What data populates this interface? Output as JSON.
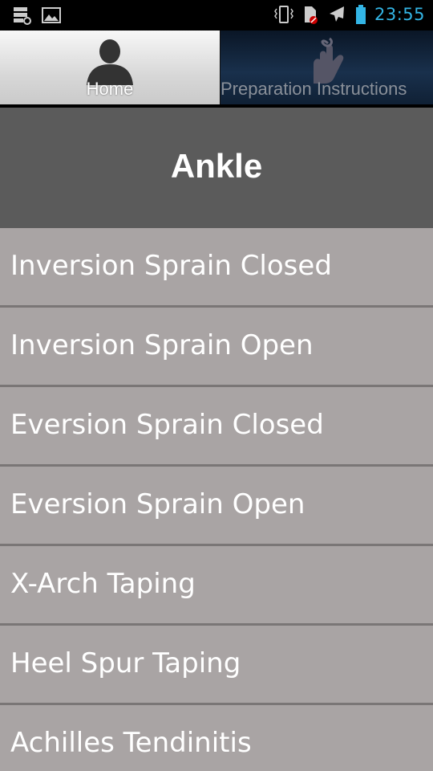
{
  "status_bar": {
    "time": "23:55",
    "left_icons": [
      "storage-icon",
      "image-icon"
    ],
    "right_icons": [
      "vibrate-icon",
      "sim-blocked-icon",
      "airplane-icon",
      "battery-icon"
    ],
    "accent_color": "#33b5e5"
  },
  "tabs": [
    {
      "label": "Home",
      "icon": "person-icon",
      "selected": true
    },
    {
      "label": "Preparation Instructions",
      "icon": "finger-string-icon",
      "selected": false
    }
  ],
  "header": {
    "title": "Ankle"
  },
  "list": {
    "items": [
      "Inversion Sprain Closed",
      "Inversion Sprain Open",
      "Eversion Sprain Closed",
      "Eversion Sprain Open",
      "X-Arch Taping",
      "Heel Spur Taping",
      "Achilles Tendinitis"
    ]
  },
  "colors": {
    "header_bg": "#5b5b5b",
    "list_bg": "#a9a4a4",
    "divider": "#7a7676"
  }
}
